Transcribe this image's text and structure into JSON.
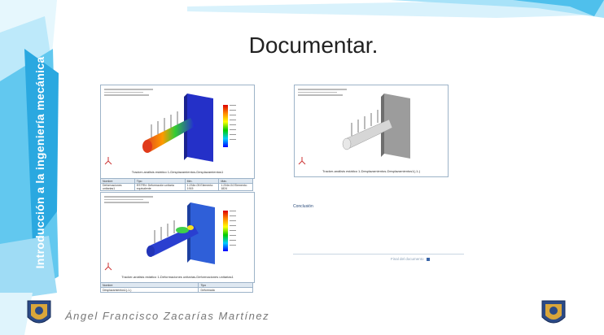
{
  "slide": {
    "title": "Documentar.",
    "side_title": "Introducción a la ingeniería mecánica",
    "author": "Ángel Francisco Zacarías Martínez",
    "left_logo": "unam-logo",
    "right_logo": "unam-logo"
  },
  "doc_left_top": {
    "caption": "Tracker-análisis estático 1-Desplazamientos-Desplazamientos1",
    "table": {
      "headers": [
        "Nombre",
        "Tipo",
        "Mín.",
        "Máx."
      ],
      "rows": [
        [
          "Deformaciones unitarias1",
          "ESTRN: Deformación unitaria equivalente",
          "1.234e-05 Elemento: 1915",
          "1.234e-04 Elemento: 1824"
        ]
      ]
    }
  },
  "doc_left_bottom": {
    "caption": "Tracker-análisis estático 1-Deformaciones unitarias-Deformaciones unitarias1",
    "table": {
      "headers": [
        "Nombre",
        "Tipo"
      ],
      "rows": [
        [
          "Desplazamientos1(-1-)",
          "Deformada"
        ]
      ]
    }
  },
  "doc_right": {
    "caption": "Tracker-análisis estático 1-Desplazamientos-Desplazamientos1(-1-)"
  },
  "conclusion": {
    "label": "Conclusión",
    "end_note": "Final del documento"
  },
  "colors": {
    "deco_light": "#cfeefb",
    "deco_mid": "#7fd3f2",
    "deco_dark": "#2aa8e0",
    "doc_border": "#9db3c8"
  }
}
